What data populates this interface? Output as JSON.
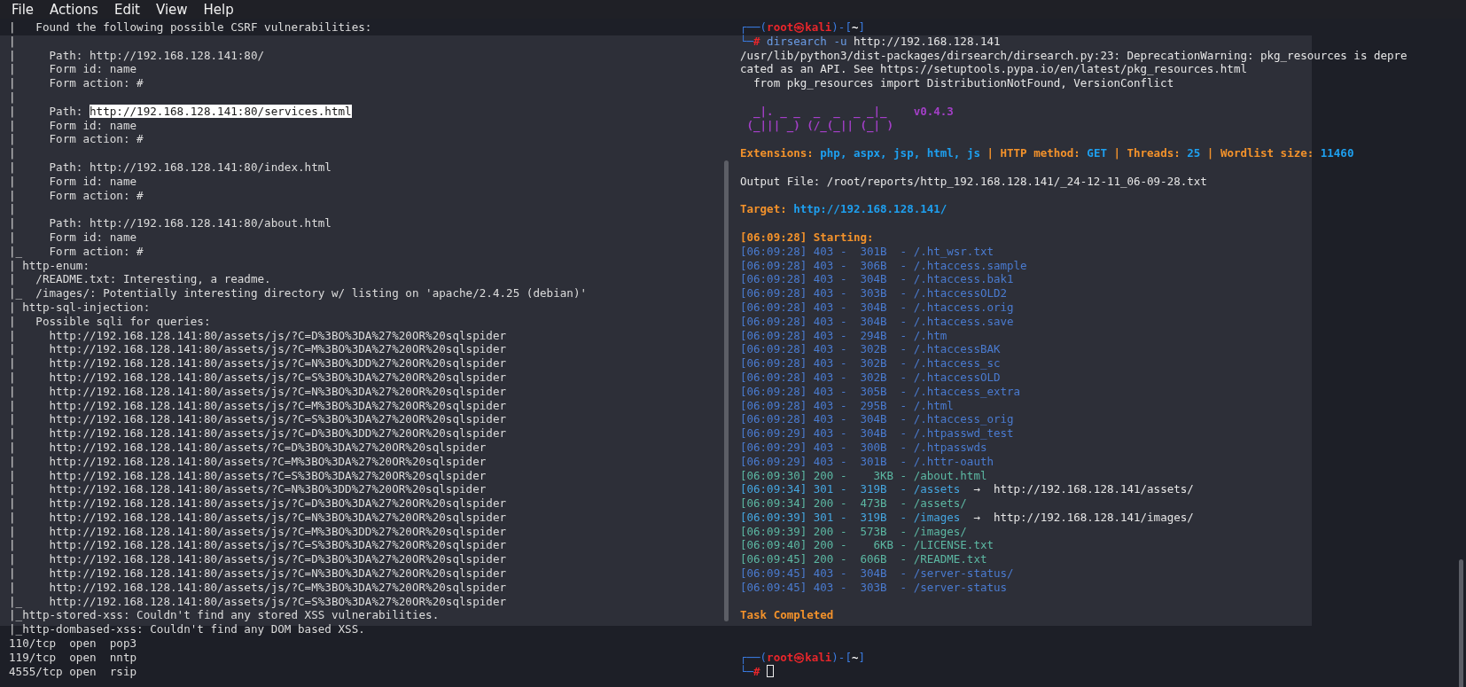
{
  "menu": [
    {
      "label": "File"
    },
    {
      "label": "Actions"
    },
    {
      "label": "Edit"
    },
    {
      "label": "View"
    },
    {
      "label": "Help"
    }
  ],
  "left_terminal": {
    "lines": [
      {
        "text": "|   Found the following possible CSRF vulnerabilities:"
      },
      {
        "text": "|"
      },
      {
        "text": "|     Path: http://192.168.128.141:80/"
      },
      {
        "text": "|     Form id: name"
      },
      {
        "text": "|     Form action: #"
      },
      {
        "text": "|"
      },
      {
        "text": "|     Path: ",
        "selection": "http://192.168.128.141:80/services.html"
      },
      {
        "text": "|     Form id: name"
      },
      {
        "text": "|     Form action: #"
      },
      {
        "text": "|"
      },
      {
        "text": "|     Path: http://192.168.128.141:80/index.html"
      },
      {
        "text": "|     Form id: name"
      },
      {
        "text": "|     Form action: #"
      },
      {
        "text": "|"
      },
      {
        "text": "|     Path: http://192.168.128.141:80/about.html"
      },
      {
        "text": "|     Form id: name"
      },
      {
        "text": "|_    Form action: #"
      },
      {
        "text": "| http-enum:"
      },
      {
        "text": "|   /README.txt: Interesting, a readme."
      },
      {
        "text": "|_  /images/: Potentially interesting directory w/ listing on 'apache/2.4.25 (debian)'"
      },
      {
        "text": "| http-sql-injection:"
      },
      {
        "text": "|   Possible sqli for queries:"
      },
      {
        "text": "|     http://192.168.128.141:80/assets/js/?C=D%3BO%3DA%27%20OR%20sqlspider"
      },
      {
        "text": "|     http://192.168.128.141:80/assets/js/?C=M%3BO%3DA%27%20OR%20sqlspider"
      },
      {
        "text": "|     http://192.168.128.141:80/assets/js/?C=N%3BO%3DD%27%20OR%20sqlspider"
      },
      {
        "text": "|     http://192.168.128.141:80/assets/js/?C=S%3BO%3DA%27%20OR%20sqlspider"
      },
      {
        "text": "|     http://192.168.128.141:80/assets/js/?C=N%3BO%3DA%27%20OR%20sqlspider"
      },
      {
        "text": "|     http://192.168.128.141:80/assets/js/?C=M%3BO%3DA%27%20OR%20sqlspider"
      },
      {
        "text": "|     http://192.168.128.141:80/assets/js/?C=S%3BO%3DA%27%20OR%20sqlspider"
      },
      {
        "text": "|     http://192.168.128.141:80/assets/js/?C=D%3BO%3DD%27%20OR%20sqlspider"
      },
      {
        "text": "|     http://192.168.128.141:80/assets/?C=D%3BO%3DA%27%20OR%20sqlspider"
      },
      {
        "text": "|     http://192.168.128.141:80/assets/?C=M%3BO%3DA%27%20OR%20sqlspider"
      },
      {
        "text": "|     http://192.168.128.141:80/assets/?C=S%3BO%3DA%27%20OR%20sqlspider"
      },
      {
        "text": "|     http://192.168.128.141:80/assets/?C=N%3BO%3DD%27%20OR%20sqlspider"
      },
      {
        "text": "|     http://192.168.128.141:80/assets/js/?C=D%3BO%3DA%27%20OR%20sqlspider"
      },
      {
        "text": "|     http://192.168.128.141:80/assets/js/?C=N%3BO%3DA%27%20OR%20sqlspider"
      },
      {
        "text": "|     http://192.168.128.141:80/assets/js/?C=M%3BO%3DD%27%20OR%20sqlspider"
      },
      {
        "text": "|     http://192.168.128.141:80/assets/js/?C=S%3BO%3DA%27%20OR%20sqlspider"
      },
      {
        "text": "|     http://192.168.128.141:80/assets/js/?C=D%3BO%3DA%27%20OR%20sqlspider"
      },
      {
        "text": "|     http://192.168.128.141:80/assets/js/?C=N%3BO%3DA%27%20OR%20sqlspider"
      },
      {
        "text": "|     http://192.168.128.141:80/assets/js/?C=M%3BO%3DA%27%20OR%20sqlspider"
      },
      {
        "text": "|_    http://192.168.128.141:80/assets/js/?C=S%3BO%3DA%27%20OR%20sqlspider"
      },
      {
        "text": "|_http-stored-xss: Couldn't find any stored XSS vulnerabilities."
      },
      {
        "text": "|_http-dombased-xss: Couldn't find any DOM based XSS."
      },
      {
        "text": "110/tcp  open  pop3"
      },
      {
        "text": "119/tcp  open  nntp"
      },
      {
        "text": "4555/tcp open  rsip"
      }
    ]
  },
  "right_terminal": {
    "lines": [
      {
        "kind": "text",
        "segments": [
          {
            "kind": "frame",
            "text": "┌──("
          },
          {
            "kind": "user",
            "text": "root㉿kali"
          },
          {
            "kind": "frame",
            "text": ")-["
          },
          {
            "kind": "cwd",
            "text": "~"
          },
          {
            "kind": "frame",
            "text": "]"
          }
        ]
      },
      {
        "kind": "text",
        "segments": [
          {
            "kind": "frame",
            "text": "└─"
          },
          {
            "kind": "user",
            "text": "#"
          },
          {
            "kind": "cmd",
            "text": " dirsearch -u"
          },
          {
            "kind": "plain",
            "text": " http://192.168.128.141"
          }
        ]
      },
      {
        "kind": "text",
        "segments": [
          {
            "kind": "plain",
            "text": "/usr/lib/python3/dist-packages/dirsearch/dirsearch.py:23: DeprecationWarning: pkg_resources is depre"
          }
        ]
      },
      {
        "kind": "text",
        "segments": [
          {
            "kind": "plain",
            "text": "cated as an API. See https://setuptools.pypa.io/en/latest/pkg_resources.html"
          }
        ]
      },
      {
        "kind": "text",
        "segments": [
          {
            "kind": "plain",
            "text": "  from pkg_resources import DistributionNotFound, VersionConflict"
          }
        ]
      },
      {
        "kind": "blank"
      },
      {
        "kind": "text",
        "segments": [
          {
            "kind": "banner",
            "text": "  _|. _ _  _  _  _ _|_    v0.4.3"
          }
        ]
      },
      {
        "kind": "text",
        "segments": [
          {
            "kind": "banner",
            "text": " (_||| _) (/_(_|| (_| )"
          }
        ]
      },
      {
        "kind": "blank"
      },
      {
        "kind": "text",
        "segments": [
          {
            "kind": "label",
            "text": "Extensions: "
          },
          {
            "kind": "value",
            "text": "php, aspx, jsp, html, js"
          },
          {
            "kind": "label",
            "text": " | HTTP method: "
          },
          {
            "kind": "value",
            "text": "GET"
          },
          {
            "kind": "label",
            "text": " | Threads: "
          },
          {
            "kind": "value",
            "text": "25"
          },
          {
            "kind": "label",
            "text": " | Wordlist size: "
          },
          {
            "kind": "value",
            "text": "11460"
          }
        ]
      },
      {
        "kind": "blank"
      },
      {
        "kind": "text",
        "segments": [
          {
            "kind": "plain",
            "text": "Output File: /root/reports/http_192.168.128.141/_24-12-11_06-09-28.txt"
          }
        ]
      },
      {
        "kind": "blank"
      },
      {
        "kind": "text",
        "segments": [
          {
            "kind": "label",
            "text": "Target: "
          },
          {
            "kind": "value",
            "text": "http://192.168.128.141/"
          }
        ]
      },
      {
        "kind": "blank"
      },
      {
        "kind": "text",
        "segments": [
          {
            "kind": "label",
            "text": "[06:09:28] Starting: "
          }
        ]
      },
      {
        "kind": "text",
        "segments": [
          {
            "kind": "forbidden",
            "text": "[06:09:28] 403 -  301B  - /.ht_wsr.txt"
          }
        ]
      },
      {
        "kind": "text",
        "segments": [
          {
            "kind": "forbidden",
            "text": "[06:09:28] 403 -  306B  - /.htaccess.sample"
          }
        ]
      },
      {
        "kind": "text",
        "segments": [
          {
            "kind": "forbidden",
            "text": "[06:09:28] 403 -  304B  - /.htaccess.bak1"
          }
        ]
      },
      {
        "kind": "text",
        "segments": [
          {
            "kind": "forbidden",
            "text": "[06:09:28] 403 -  303B  - /.htaccessOLD2"
          }
        ]
      },
      {
        "kind": "text",
        "segments": [
          {
            "kind": "forbidden",
            "text": "[06:09:28] 403 -  304B  - /.htaccess.orig"
          }
        ]
      },
      {
        "kind": "text",
        "segments": [
          {
            "kind": "forbidden",
            "text": "[06:09:28] 403 -  304B  - /.htaccess.save"
          }
        ]
      },
      {
        "kind": "text",
        "segments": [
          {
            "kind": "forbidden",
            "text": "[06:09:28] 403 -  294B  - /.htm"
          }
        ]
      },
      {
        "kind": "text",
        "segments": [
          {
            "kind": "forbidden",
            "text": "[06:09:28] 403 -  302B  - /.htaccessBAK"
          }
        ]
      },
      {
        "kind": "text",
        "segments": [
          {
            "kind": "forbidden",
            "text": "[06:09:28] 403 -  302B  - /.htaccess_sc"
          }
        ]
      },
      {
        "kind": "text",
        "segments": [
          {
            "kind": "forbidden",
            "text": "[06:09:28] 403 -  302B  - /.htaccessOLD"
          }
        ]
      },
      {
        "kind": "text",
        "segments": [
          {
            "kind": "forbidden",
            "text": "[06:09:28] 403 -  305B  - /.htaccess_extra"
          }
        ]
      },
      {
        "kind": "text",
        "segments": [
          {
            "kind": "forbidden",
            "text": "[06:09:28] 403 -  295B  - /.html"
          }
        ]
      },
      {
        "kind": "text",
        "segments": [
          {
            "kind": "forbidden",
            "text": "[06:09:28] 403 -  304B  - /.htaccess_orig"
          }
        ]
      },
      {
        "kind": "text",
        "segments": [
          {
            "kind": "forbidden",
            "text": "[06:09:29] 403 -  304B  - /.htpasswd_test"
          }
        ]
      },
      {
        "kind": "text",
        "segments": [
          {
            "kind": "forbidden",
            "text": "[06:09:29] 403 -  300B  - /.htpasswds"
          }
        ]
      },
      {
        "kind": "text",
        "segments": [
          {
            "kind": "forbidden",
            "text": "[06:09:29] 403 -  301B  - /.httr-oauth"
          }
        ]
      },
      {
        "kind": "text",
        "segments": [
          {
            "kind": "ok",
            "text": "[06:09:30] 200 -    3KB - /about.html"
          }
        ]
      },
      {
        "kind": "text",
        "segments": [
          {
            "kind": "redirect",
            "text": "[06:09:34] 301 -  319B  - /assets"
          },
          {
            "kind": "plain",
            "text": "  →  http://192.168.128.141/assets/"
          }
        ]
      },
      {
        "kind": "text",
        "segments": [
          {
            "kind": "ok",
            "text": "[06:09:34] 200 -  473B  - /assets/"
          }
        ]
      },
      {
        "kind": "text",
        "segments": [
          {
            "kind": "redirect",
            "text": "[06:09:39] 301 -  319B  - /images"
          },
          {
            "kind": "plain",
            "text": "  →  http://192.168.128.141/images/"
          }
        ]
      },
      {
        "kind": "text",
        "segments": [
          {
            "kind": "ok",
            "text": "[06:09:39] 200 -  573B  - /images/"
          }
        ]
      },
      {
        "kind": "text",
        "segments": [
          {
            "kind": "ok",
            "text": "[06:09:40] 200 -    6KB - /LICENSE.txt"
          }
        ]
      },
      {
        "kind": "text",
        "segments": [
          {
            "kind": "ok",
            "text": "[06:09:45] 200 -  606B  - /README.txt"
          }
        ]
      },
      {
        "kind": "text",
        "segments": [
          {
            "kind": "forbidden",
            "text": "[06:09:45] 403 -  304B  - /server-status/"
          }
        ]
      },
      {
        "kind": "text",
        "segments": [
          {
            "kind": "forbidden",
            "text": "[06:09:45] 403 -  303B  - /server-status"
          }
        ]
      },
      {
        "kind": "blank"
      },
      {
        "kind": "text",
        "segments": [
          {
            "kind": "label",
            "text": "Task Completed"
          }
        ]
      },
      {
        "kind": "blank"
      },
      {
        "kind": "blank"
      },
      {
        "kind": "text",
        "segments": [
          {
            "kind": "frame",
            "text": "┌──("
          },
          {
            "kind": "user",
            "text": "root㉿kali"
          },
          {
            "kind": "frame",
            "text": ")-["
          },
          {
            "kind": "cwd",
            "text": "~"
          },
          {
            "kind": "frame",
            "text": "]"
          }
        ]
      },
      {
        "kind": "input",
        "segments": [
          {
            "kind": "frame",
            "text": "└─"
          },
          {
            "kind": "user",
            "text": "#"
          }
        ]
      }
    ]
  }
}
